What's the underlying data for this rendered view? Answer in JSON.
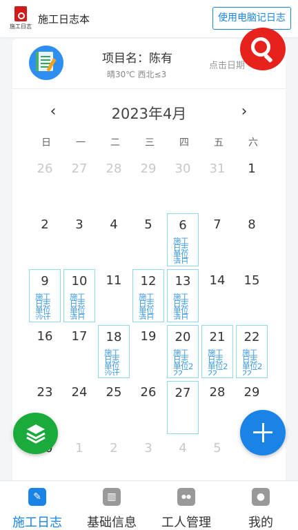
{
  "header": {
    "logo_text": "施工日志",
    "title": "施工日志本",
    "pc_button": "使用电脑记日志"
  },
  "project": {
    "name": "项目名：陈有",
    "weather": "晴30℃ 西北≤3",
    "date_hint": "点击日期"
  },
  "calendar": {
    "month_label": "2023年4月",
    "prev": "‹",
    "next": "›",
    "weekdays": [
      "日",
      "一",
      "二",
      "三",
      "四",
      "五",
      "六"
    ],
    "days": [
      {
        "d": "26",
        "other": true
      },
      {
        "d": "27",
        "other": true
      },
      {
        "d": "28",
        "other": true
      },
      {
        "d": "29",
        "other": true
      },
      {
        "d": "30",
        "other": true
      },
      {
        "d": "31",
        "other": true
      },
      {
        "d": "1"
      },
      {
        "d": "2"
      },
      {
        "d": "3"
      },
      {
        "d": "4"
      },
      {
        "d": "5"
      },
      {
        "d": "6",
        "log": "施工日志单位清日"
      },
      {
        "d": "7"
      },
      {
        "d": "8"
      },
      {
        "d": "9",
        "log": "施工日志单位沙计"
      },
      {
        "d": "10",
        "log": "施工日志单位清日"
      },
      {
        "d": "11"
      },
      {
        "d": "12",
        "log": "施工日志单位清日"
      },
      {
        "d": "13",
        "log": "施工日志单位清日"
      },
      {
        "d": "14"
      },
      {
        "d": "15"
      },
      {
        "d": "16"
      },
      {
        "d": "17"
      },
      {
        "d": "18",
        "log": "施工日志单位沙计"
      },
      {
        "d": "19"
      },
      {
        "d": "20",
        "log": "施工日志单位222"
      },
      {
        "d": "21",
        "log": "施工日志单位222"
      },
      {
        "d": "22",
        "log": "施工日志单位222"
      },
      {
        "d": "23"
      },
      {
        "d": "24"
      },
      {
        "d": "25"
      },
      {
        "d": "26"
      },
      {
        "d": "27",
        "log": ""
      },
      {
        "d": "28"
      },
      {
        "d": "29"
      },
      {
        "d": "30"
      },
      {
        "d": "1",
        "other": true
      },
      {
        "d": "2",
        "other": true
      },
      {
        "d": "3",
        "other": true
      },
      {
        "d": "4",
        "other": true
      },
      {
        "d": "5",
        "other": true
      },
      {
        "d": "6",
        "other": true
      }
    ]
  },
  "fabs": {
    "search_icon": "search-icon",
    "layers_icon": "layers-icon",
    "add_icon": "plus-icon"
  },
  "bottom_nav": [
    {
      "label": "施工日志",
      "icon": "notebook-icon",
      "active": true
    },
    {
      "label": "基础信息",
      "icon": "books-icon",
      "active": false
    },
    {
      "label": "工人管理",
      "icon": "group-icon",
      "active": false
    },
    {
      "label": "我的",
      "icon": "user-icon",
      "active": false
    }
  ],
  "colors": {
    "accent": "#1a83e8",
    "search_fab": "#e7211c",
    "layers_fab": "#1aab3c",
    "log_border": "#8fd9ef"
  }
}
